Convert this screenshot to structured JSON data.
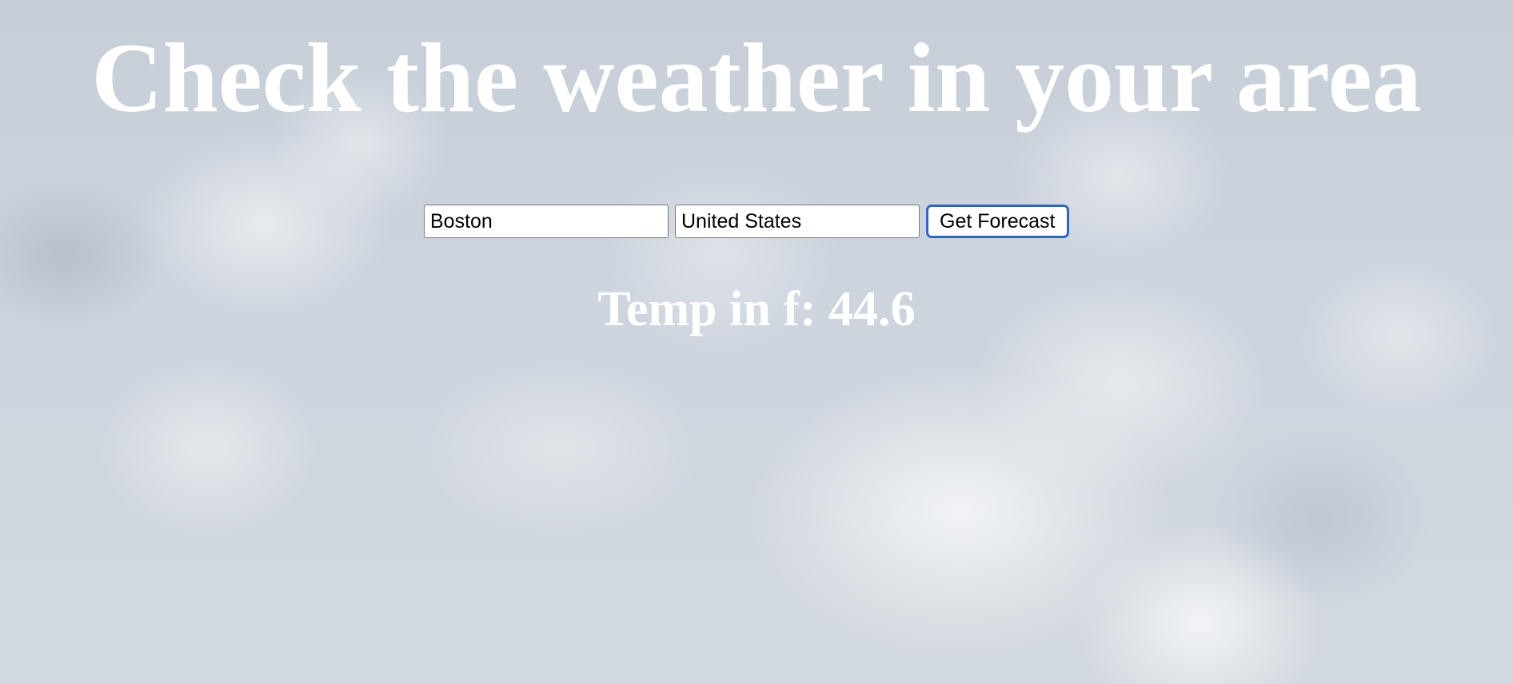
{
  "page": {
    "title": "Check the weather in your area"
  },
  "form": {
    "city_value": "Boston",
    "country_value": "United States",
    "submit_label": "Get Forecast"
  },
  "result": {
    "text": "Temp in f: 44.6"
  },
  "colors": {
    "background": "#c9d1da",
    "text": "#ffffff",
    "button_focus_border": "#2f65c3"
  }
}
